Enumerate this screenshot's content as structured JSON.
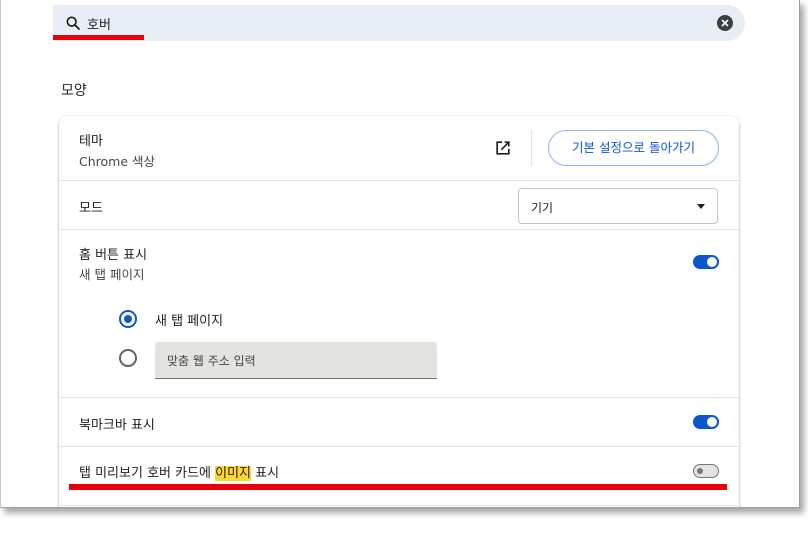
{
  "search": {
    "query": "호버"
  },
  "section": {
    "title": "모양"
  },
  "theme": {
    "label": "테마",
    "value": "Chrome 색상",
    "reset_label": "기본 설정으로 돌아가기"
  },
  "mode": {
    "label": "모드",
    "selected": "기기"
  },
  "home_button": {
    "label": "홈 버튼 표시",
    "value": "새 탭 페이지",
    "enabled": true,
    "options": [
      {
        "label": "새 탭 페이지",
        "checked": true
      },
      {
        "placeholder": "맞춤 웹 주소 입력",
        "checked": false
      }
    ]
  },
  "bookmarks_bar": {
    "label": "북마크바 표시",
    "enabled": true
  },
  "tab_preview": {
    "label_before": "탭 미리보기 호버 카드에 ",
    "label_highlight": "이미지",
    "label_after": " 표시",
    "enabled": false
  },
  "colors": {
    "accent": "#0b57d0",
    "highlight": "#fdd835",
    "annotation_red": "#e8000b"
  }
}
